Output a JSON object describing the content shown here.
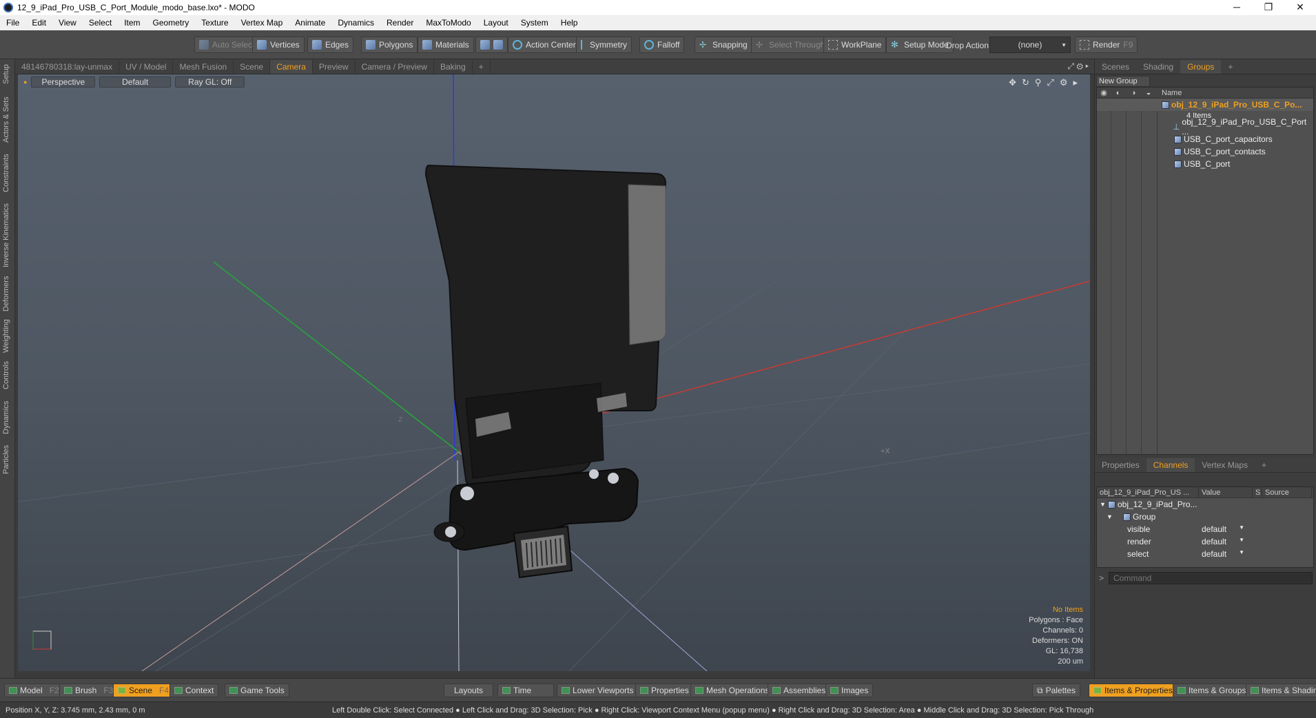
{
  "window": {
    "title": "12_9_iPad_Pro_USB_C_Port_Module_modo_base.lxo* - MODO",
    "controls": [
      "─",
      "❐",
      "✕"
    ]
  },
  "menu": [
    "File",
    "Edit",
    "View",
    "Select",
    "Item",
    "Geometry",
    "Texture",
    "Vertex Map",
    "Animate",
    "Dynamics",
    "Render",
    "MaxToModo",
    "Layout",
    "System",
    "Help"
  ],
  "toolbar": {
    "auto_select": "Auto Select",
    "vertices": "Vertices",
    "edges": "Edges",
    "polygons": "Polygons",
    "materials": "Materials",
    "action_center": "Action Center",
    "symmetry": "Symmetry",
    "falloff": "Falloff",
    "snapping": "Snapping",
    "select_through": "Select Through",
    "workplane": "WorkPlane",
    "setup_mode": "Setup Mode",
    "drop_action_label": "Drop Action",
    "drop_action_value": "(none)",
    "render": "Render",
    "render_key": "F9"
  },
  "left_tabs": [
    "Setup",
    "Actors & Sets",
    "Constraints",
    "Inverse Kinematics",
    "Deformers",
    "Weighting",
    "Controls",
    "Dynamics",
    "Particles"
  ],
  "viewport_tabs": [
    "48146780318:lay-unmax",
    "UV / Model",
    "Mesh Fusion",
    "Scene",
    "Camera",
    "Preview",
    "Camera / Preview",
    "Baking",
    "+"
  ],
  "viewport_active_tab": "Camera",
  "viewport": {
    "view_mode": "Perspective",
    "shading": "Default",
    "raygl": "Ray GL: Off",
    "axis_x_label": "+X",
    "axis_z_label": "Z",
    "stats": {
      "selection": "No Items",
      "polygons": "Polygons : Face",
      "channels": "Channels: 0",
      "deformers": "Deformers: ON",
      "gl": "GL: 16,738",
      "scale": "200 um"
    }
  },
  "right_panel": {
    "top_tabs": [
      "Scenes",
      "Shading",
      "Groups",
      "+"
    ],
    "active_top_tab": "Groups",
    "new_group": "New Group",
    "name_col": "Name",
    "group": {
      "name": "obj_12_9_iPad_Pro_USB_C_Po...",
      "count": "4 Items"
    },
    "items": [
      "obj_12_9_iPad_Pro_USB_C_Port ...",
      "USB_C_port_capacitors",
      "USB_C_port_contacts",
      "USB_C_port"
    ],
    "bottom_tabs": [
      "Properties",
      "Channels",
      "Vertex Maps",
      "+"
    ],
    "active_bottom_tab": "Channels",
    "channels": {
      "col_name": "obj_12_9_iPad_Pro_US ...",
      "col_value": "Value",
      "col_s": "S",
      "col_source": "Source",
      "item": "obj_12_9_iPad_Pro...",
      "group": "Group",
      "rows": [
        {
          "name": "visible",
          "value": "default"
        },
        {
          "name": "render",
          "value": "default"
        },
        {
          "name": "select",
          "value": "default"
        }
      ]
    },
    "command_placeholder": "Command"
  },
  "bottom_bar": {
    "model": "Model",
    "model_key": "F2",
    "brush": "Brush",
    "brush_key": "F3",
    "scene": "Scene",
    "scene_key": "F4",
    "context": "Context",
    "game_tools": "Game Tools",
    "layouts": "Layouts",
    "time": "Time",
    "lower_viewports": "Lower Viewports",
    "properties": "Properties",
    "mesh_operations": "Mesh Operations",
    "assemblies": "Assemblies",
    "images": "Images",
    "palettes": "Palettes",
    "items_properties": "Items & Properties",
    "items_groups": "Items & Groups",
    "items_shading": "Items & Shading"
  },
  "status": {
    "position": "Position X, Y, Z:   3.745 mm, 2.43 mm, 0 m",
    "hints": "Left Double Click: Select Connected ● Left Click and Drag: 3D Selection: Pick ● Right Click: Viewport Context Menu (popup menu) ● Right Click and Drag: 3D Selection: Area ● Middle Click and Drag: 3D Selection: Pick Through"
  },
  "colors": {
    "accent": "#f0a020",
    "viewport_bg": "#535c68"
  }
}
